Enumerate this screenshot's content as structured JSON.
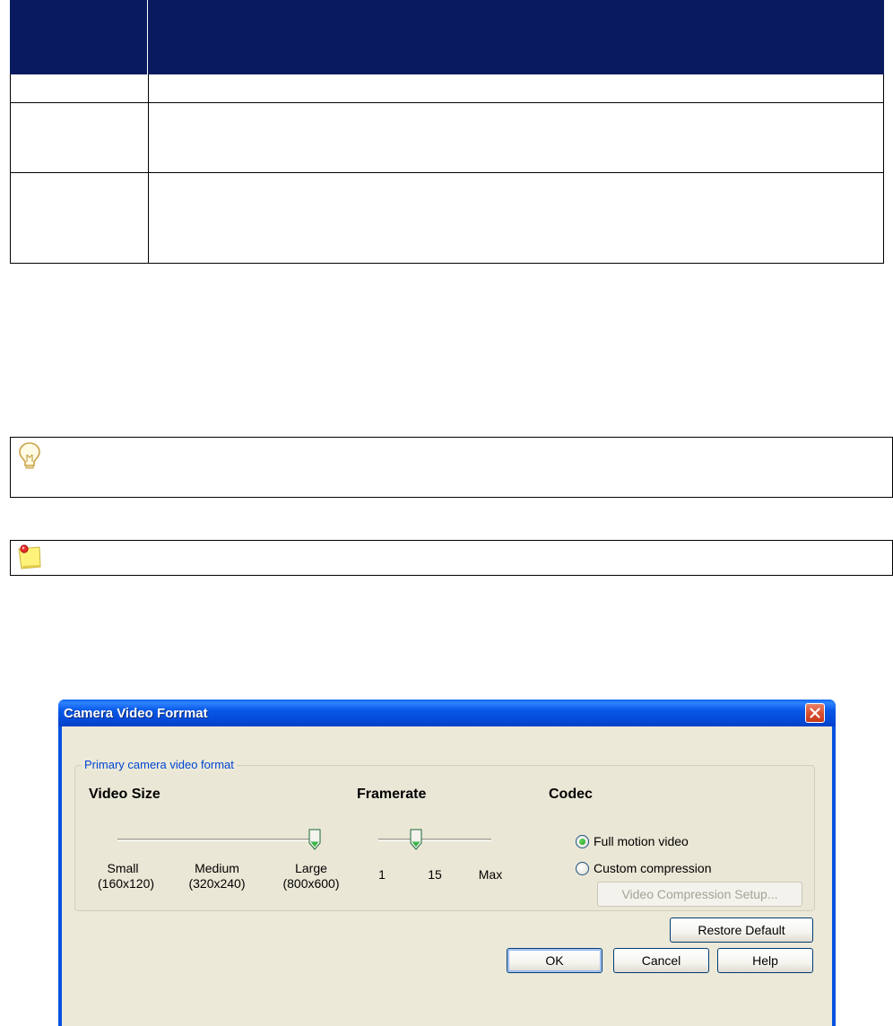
{
  "dialog": {
    "title": "Camera Video Forrmat",
    "group_label": "Primary camera video format",
    "video_size": {
      "heading": "Video Size",
      "slider_value": "Large",
      "ticks": [
        {
          "line1": "Small",
          "line2": "(160x120)"
        },
        {
          "line1": "Medium",
          "line2": "(320x240)"
        },
        {
          "line1": "Large",
          "line2": "(800x600)"
        }
      ]
    },
    "framerate": {
      "heading": "Framerate",
      "slider_value": 15,
      "ticks": [
        "1",
        "15",
        "Max"
      ]
    },
    "codec": {
      "heading": "Codec",
      "options": [
        "Full motion video",
        "Custom compression"
      ],
      "selected": "Full motion video",
      "setup_button": "Video Compression Setup..."
    },
    "buttons": {
      "restore_default": "Restore Default",
      "ok": "OK",
      "cancel": "Cancel",
      "help": "Help"
    }
  },
  "icons": {
    "tip": "lightbulb-icon",
    "note": "sticky-note-icon",
    "close": "close-icon"
  },
  "colors": {
    "table_header": "#0a1a5e",
    "title_bar": "#0449d6",
    "dialog_face": "#ece9d8",
    "close_button": "#d84e2d",
    "group_label": "#0046d5"
  }
}
